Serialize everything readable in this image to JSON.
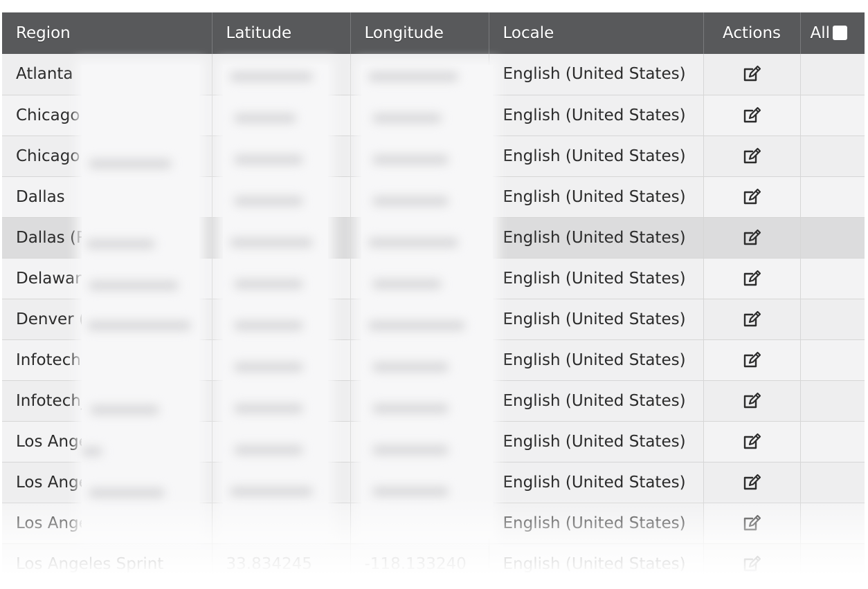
{
  "table": {
    "headers": {
      "region": "Region",
      "latitude": "Latitude",
      "longitude": "Longitude",
      "locale": "Locale",
      "actions": "Actions",
      "all": "All"
    },
    "rows": [
      {
        "region": "Atlanta",
        "latitude": "",
        "longitude": "",
        "locale": "English (United States)"
      },
      {
        "region": "Chicago",
        "latitude": "",
        "longitude": "",
        "locale": "English (United States)"
      },
      {
        "region": "Chicago",
        "latitude": "",
        "longitude": "",
        "locale": "English (United States)"
      },
      {
        "region": "Dallas",
        "latitude": "",
        "longitude": "",
        "locale": "English (United States)"
      },
      {
        "region": "Dallas (R",
        "latitude": "",
        "longitude": "",
        "locale": "English (United States)"
      },
      {
        "region": "Delaware",
        "latitude": "",
        "longitude": "",
        "locale": "English (United States)"
      },
      {
        "region": "Denver (",
        "latitude": "",
        "longitude": "",
        "locale": "English (United States)"
      },
      {
        "region": "Infotech",
        "latitude": "",
        "longitude": "",
        "locale": "English (United States)"
      },
      {
        "region": "Infotech_",
        "latitude": "",
        "longitude": "",
        "locale": "English (United States)"
      },
      {
        "region": "Los Ange",
        "latitude": "",
        "longitude": "",
        "locale": "English (United States)"
      },
      {
        "region": "Los Ange",
        "latitude": "",
        "longitude": "",
        "locale": "English (United States)"
      },
      {
        "region": "Los Ange",
        "latitude": "",
        "longitude": "",
        "locale": "English (United States)"
      },
      {
        "region": "Los Angeles Sprint",
        "latitude": "33.834245",
        "longitude": "-118.133240",
        "locale": "English (United States)"
      }
    ]
  },
  "icons": {
    "edit": "edit-icon",
    "checkbox": "checkbox-icon"
  },
  "colors": {
    "header_bg": "#58595b",
    "row_bg": "#eeeeef",
    "row_highlight": "#dcdcdd"
  }
}
